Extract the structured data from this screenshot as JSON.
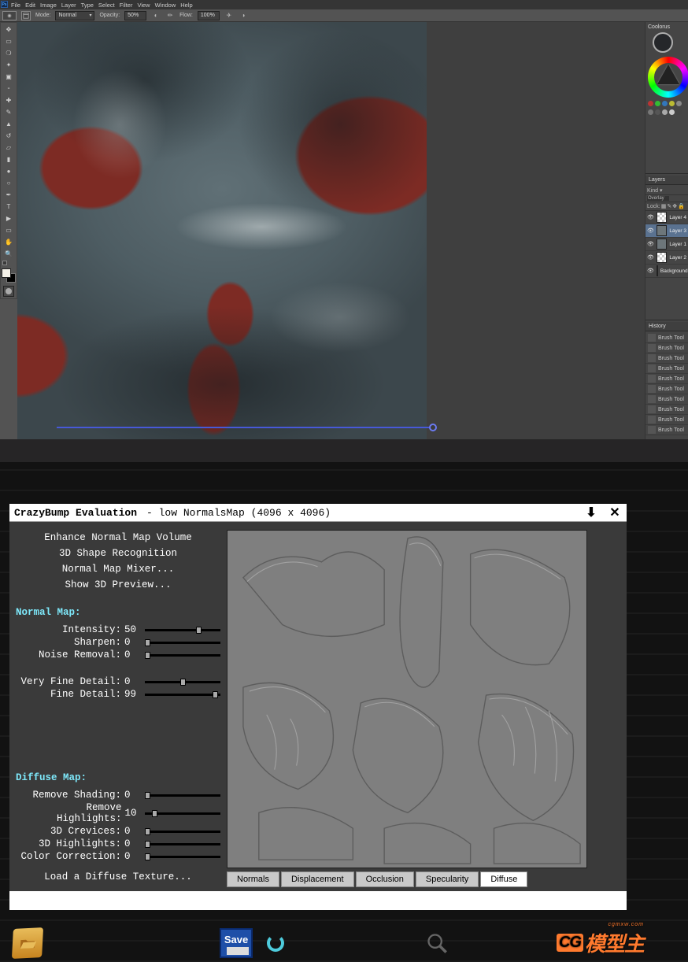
{
  "ps": {
    "logo": "Ps",
    "menubar": [
      "File",
      "Edit",
      "Image",
      "Layer",
      "Type",
      "Select",
      "Filter",
      "View",
      "Window",
      "Help"
    ],
    "options": {
      "mode_label": "Mode:",
      "mode_value": "Normal",
      "opacity_label": "Opacity:",
      "opacity_value": "50%",
      "flow_label": "Flow:",
      "flow_value": "100%"
    },
    "tools": [
      "move-tool",
      "marquee-tool",
      "lasso-tool",
      "quick-select-tool",
      "crop-tool",
      "eyedropper-tool",
      "healing-tool",
      "brush-tool",
      "stamp-tool",
      "history-brush-tool",
      "eraser-tool",
      "gradient-tool",
      "blur-tool",
      "dodge-tool",
      "pen-tool",
      "type-tool",
      "path-select-tool",
      "rectangle-tool",
      "hand-tool",
      "zoom-tool"
    ],
    "panels": {
      "coolorus_title": "Coolorus",
      "layers_title": "Layers",
      "layers_kind": "Kind",
      "layers_blend": "Overlay",
      "layers_lock": "Lock:",
      "layers": [
        {
          "name": "Layer 4",
          "visible": true,
          "thumb": "checker",
          "selected": false
        },
        {
          "name": "Layer 3",
          "visible": true,
          "thumb": "fill",
          "selected": true
        },
        {
          "name": "Layer 1",
          "visible": true,
          "thumb": "fill",
          "selected": false
        },
        {
          "name": "Layer 2",
          "visible": true,
          "thumb": "checker",
          "selected": false
        },
        {
          "name": "Background",
          "visible": true,
          "thumb": "fill",
          "selected": false
        }
      ],
      "history_title": "History",
      "history_item": "Brush Tool",
      "history_count": 10
    }
  },
  "cb": {
    "title_main": "CrazyBump Evaluation",
    "title_sub": "- low NormalsMap (4096 x 4096)",
    "buttons": {
      "enhance": "Enhance Normal Map Volume",
      "shape": "3D Shape Recognition",
      "mixer": "Normal Map Mixer...",
      "preview3d": "Show 3D Preview..."
    },
    "normal_title": "Normal Map:",
    "normal_sliders": [
      {
        "label": "Intensity:",
        "value": 50,
        "pos": 72
      },
      {
        "label": "Sharpen:",
        "value": 0,
        "pos": 0
      },
      {
        "label": "Noise Removal:",
        "value": 0,
        "pos": 0
      }
    ],
    "normal_detail_sliders": [
      {
        "label": "Very Fine Detail:",
        "value": 0,
        "pos": 50
      },
      {
        "label": "Fine Detail:",
        "value": 99,
        "pos": 96
      }
    ],
    "diffuse_title": "Diffuse Map:",
    "diffuse_sliders": [
      {
        "label": "Remove Shading:",
        "value": 0,
        "pos": 0
      },
      {
        "label": "Remove Highlights:",
        "value": 10,
        "pos": 10
      },
      {
        "label": "3D Crevices:",
        "value": 0,
        "pos": 0
      },
      {
        "label": "3D Highlights:",
        "value": 0,
        "pos": 0
      },
      {
        "label": "Color Correction:",
        "value": 0,
        "pos": 0
      }
    ],
    "load_btn": "Load a Diffuse Texture...",
    "tabs": [
      "Normals",
      "Displacement",
      "Occlusion",
      "Specularity",
      "Diffuse"
    ],
    "active_tab": 4,
    "bottom": {
      "open": "Open",
      "save": "Save"
    },
    "watermark": {
      "cg": "CG",
      "text": "模型主",
      "sub": "cgmxw.com"
    }
  }
}
